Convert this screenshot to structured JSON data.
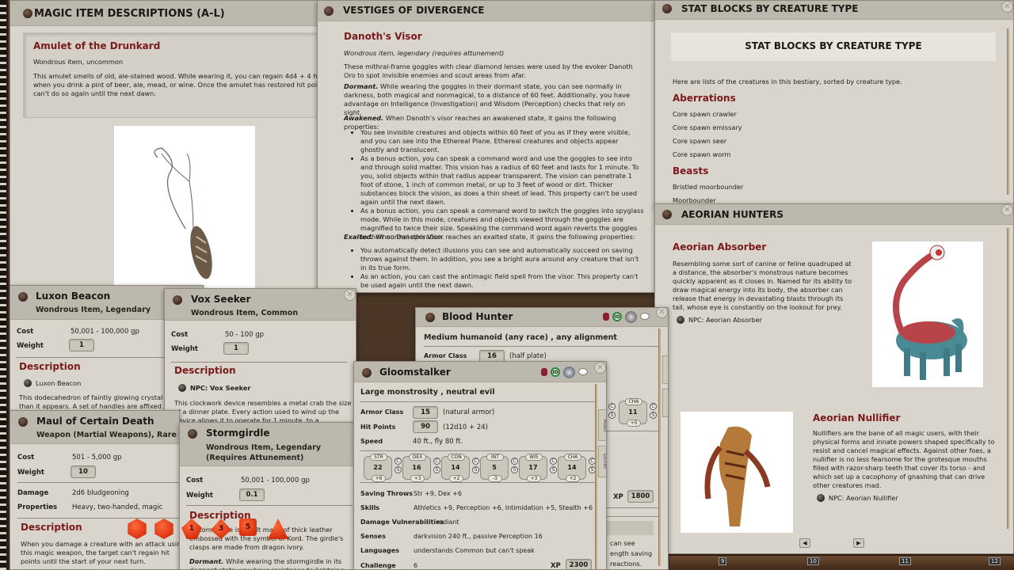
{
  "windows": {
    "magic_items": {
      "title": "MAGIC ITEM DESCRIPTIONS (A-L)",
      "entry_title": "Amulet of the Drunkard",
      "entry_type": "Wondrous item, uncommon",
      "entry_text": "This amulet smells of old, ale-stained wood. While wearing it, you can regain 4d4 + 4 hit points when you drink a pint of beer, ale, mead, or wine. Once the amulet has restored hit points, it can't do so again until the next dawn."
    },
    "vestiges": {
      "title": "VESTIGES OF DIVERGENCE",
      "entry_title": "Danoth's Visor",
      "entry_type": "Wondrous item, legendary (requires attunement)",
      "intro": "These mithral-frame goggles with clear diamond lenses were used by the evoker Danoth Oro to spot invisible enemies and scout areas from afar.",
      "dormant_label": "Dormant.",
      "dormant_text": "While wearing the goggles in their dormant state, you can see normally in darkness, both magical and nonmagical, to a distance of 60 feet. Additionally, you have advantage on Intelligence (Investigation) and Wisdom (Perception) checks that rely on sight.",
      "awakened_label": "Awakened.",
      "awakened_text": "When Danoth's visor reaches an awakened state, it gains the following properties:",
      "awakened_bullets": [
        "You see invisible creatures and objects within 60 feet of you as if they were visible, and you can see into the Ethereal Plane. Ethereal creatures and objects appear ghostly and translucent.",
        "As a bonus action, you can speak a command word and use the goggles to see into and through solid matter. This vision has a radius of 60 feet and lasts for 1 minute. To you, solid objects within that radius appear transparent. The vision can penetrate 1 foot of stone, 1 inch of common metal, or up to 3 feet of wood or dirt. Thicker substances block the vision, as does a thin sheet of lead. This property can't be used again until the next dawn.",
        "As a bonus action, you can speak a command word to switch the goggles into spyglass mode. While in this mode, creatures and objects viewed through the goggles are magnified to twice their size. Speaking the command word again reverts the goggles to their normal operation."
      ],
      "exalted_label": "Exalted.",
      "exalted_text": "When Danoth's Visor reaches an exalted state, it gains the following properties:",
      "exalted_bullets": [
        "You automatically detect illusions you can see and automatically succeed on saving throws against them. In addition, you see a bright aura around any creature that isn't in its true form.",
        "As an action, you can cast the antimagic field spell from the visor. This property can't be used again until the next dawn."
      ]
    },
    "stat_blocks": {
      "title": "STAT BLOCKS BY CREATURE TYPE",
      "banner": "STAT BLOCKS BY CREATURE TYPE",
      "intro": "Here are lists of the creatures in this bestiary, sorted by creature type.",
      "groups": [
        {
          "name": "Aberrations",
          "items": [
            "Core spawn crawler",
            "Core spawn emissary",
            "Core spawn seer",
            "Core spawn worm"
          ]
        },
        {
          "name": "Beasts",
          "items": [
            "Bristled moorbounder",
            "Moorbounder"
          ]
        }
      ]
    },
    "aeorian": {
      "title": "AEORIAN HUNTERS",
      "absorber_title": "Aeorian Absorber",
      "absorber_text": "Resembling some sort of canine or feline quadruped at a distance, the absorber's monstrous nature becomes quickly apparent as it closes in. Named for its ability to draw magical energy into its body, the absorber can release that energy in devastating blasts through its tail, whose eye is constantly on the lookout for prey.",
      "absorber_link": "NPC: Aeorian Absorber",
      "nullifier_title": "Aeorian Nullifier",
      "nullifier_text": "Nullifiers are the bane of all magic users, with their physical forms and innate powers shaped specifically to resist and cancel magical effects. Against other foes, a nullifier is no less fearsome for the grotesque mouths filled with razor-sharp teeth that cover its torso - and which set up a cacophony of gnashing that can drive other creatures mad.",
      "nullifier_link": "NPC: Aeorian Nullifier",
      "prev": "◀",
      "next": "▶"
    },
    "luxon": {
      "title": "Luxon Beacon",
      "subtitle": "Wondrous Item, Legendary",
      "cost_label": "Cost",
      "cost": "50,001 - 100,000 gp",
      "weight_label": "Weight",
      "weight": "1",
      "desc_label": "Description",
      "link": "Luxon Beacon",
      "text": "This dodecahedron of faintly glowing crystal is heavier than it appears. A set of handles are affixed to its"
    },
    "vox": {
      "title": "Vox Seeker",
      "subtitle": "Wondrous Item, Common",
      "cost_label": "Cost",
      "cost": "50 - 100 gp",
      "weight_label": "Weight",
      "weight": "1",
      "desc_label": "Description",
      "link": "NPC: Vox Seeker",
      "text": "This clockwork device resembles a metal crab the size of a dinner plate. Every action used to wind up the device allows it to operate for 1 minute, to a"
    },
    "maul": {
      "title": "Maul of Certain Death",
      "subtitle": "Weapon (Martial Weapons), Rare",
      "cost_label": "Cost",
      "cost": "501 - 5,000 gp",
      "weight_label": "Weight",
      "weight": "10",
      "damage_label": "Damage",
      "damage": "2d6 bludgeoning",
      "properties_label": "Properties",
      "properties": "Heavy, two-handed, magic",
      "desc_label": "Description",
      "text": "When you damage a creature with an attack using this magic weapon, the target can't regain hit points until the start of your next turn."
    },
    "stormgirdle": {
      "title": "Stormgirdle",
      "subtitle": "Wondrous Item, Legendary (Requires Attunement)",
      "cost_label": "Cost",
      "cost": "50,001 - 100,000 gp",
      "weight_label": "Weight",
      "weight": "0.1",
      "desc_label": "Description",
      "text": "A stormgirdle is a belt made of thick leather embossed with the symbol of Kord. The girdle's clasps are made from dragon ivory.",
      "dormant_label": "Dormant.",
      "dormant_text": "While wearing the stormgirdle in its dormant state, you have resistance to lightning"
    },
    "blood_hunter": {
      "title": "Blood Hunter",
      "type": "Medium humanoid (any race) , any alignment",
      "ac_label": "Armor Class",
      "ac": "16",
      "ac_note": "(half plate)",
      "cha_label": "CHA",
      "cha": "11",
      "cha_mod": "+0",
      "xp_label": "XP",
      "xp": "1800",
      "text_frag": [
        "can see",
        "ength saving",
        "reactions."
      ],
      "tabs": [
        "Main",
        "Other"
      ]
    },
    "gloomstalker": {
      "title": "Gloomstalker",
      "type": "Large monstrosity , neutral evil",
      "ac_label": "Armor Class",
      "ac": "15",
      "ac_note": "(natural armor)",
      "hp_label": "Hit Points",
      "hp": "90",
      "hp_note": "(12d10 + 24)",
      "speed_label": "Speed",
      "speed": "40 ft., fly 80 ft.",
      "abilities": [
        {
          "name": "STR",
          "score": "22",
          "mod": "+6"
        },
        {
          "name": "DEX",
          "score": "16",
          "mod": "+3"
        },
        {
          "name": "CON",
          "score": "14",
          "mod": "+2"
        },
        {
          "name": "INT",
          "score": "5",
          "mod": "-3"
        },
        {
          "name": "WIS",
          "score": "17",
          "mod": "+3"
        },
        {
          "name": "CHA",
          "score": "14",
          "mod": "+2"
        }
      ],
      "saves_label": "Saving Throws",
      "saves": "Str +9, Dex +6",
      "skills_label": "Skills",
      "skills": "Athletics +9, Perception +6, Intimidation +5, Stealth +6",
      "vuln_label": "Damage Vulnerabilities",
      "vuln": "radiant",
      "senses_label": "Senses",
      "senses": "darkvision 240 ft., passive Perception 16",
      "languages_label": "Languages",
      "languages": "understands Common but can't speak",
      "challenge_label": "Challenge",
      "challenge": "6",
      "xp_label": "XP",
      "xp": "2300",
      "tabs": [
        "Main",
        "Other"
      ]
    }
  },
  "dice": [
    "d20",
    "d20",
    "d10",
    "d8",
    "d6",
    "d4"
  ],
  "dice_faces": [
    "",
    "",
    "1",
    "3",
    "5",
    ""
  ],
  "hotbar": [
    "9",
    "10",
    "11",
    "12"
  ],
  "colors": {
    "accent_red": "#7a1a1a",
    "panel": "#d9d5cc",
    "header": "#bdb8ae",
    "dice": "#e8401a"
  }
}
